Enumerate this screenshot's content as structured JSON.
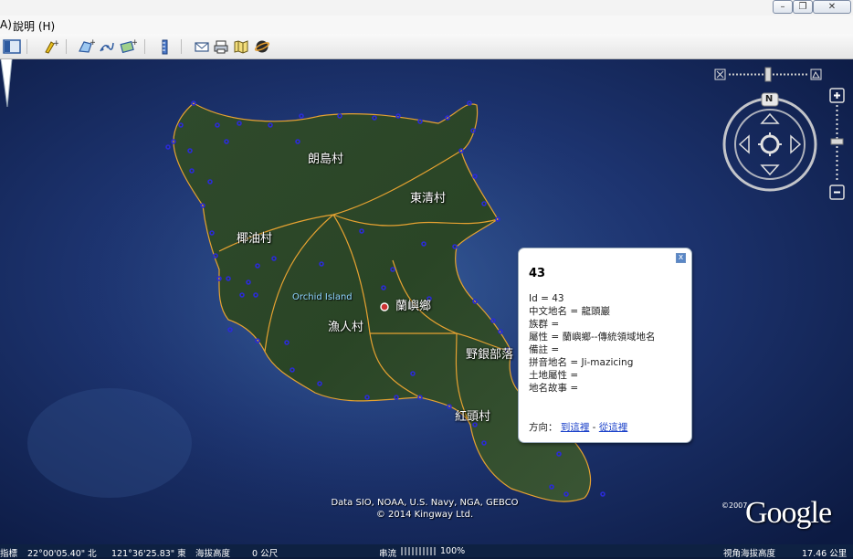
{
  "menu": {
    "items": [
      "A)",
      "說明 (H)"
    ]
  },
  "window": {
    "minimize": "–",
    "restore": "❐",
    "close": "✕"
  },
  "toolbar": {
    "icons": [
      "sidebar-toggle-icon",
      "add-placemark-icon",
      "add-polygon-icon",
      "add-path-icon",
      "add-image-overlay-icon",
      "ruler-icon",
      "email-icon",
      "print-icon",
      "google-maps-icon",
      "sky-planet-icon"
    ]
  },
  "navigation": {
    "compass_north": "N"
  },
  "villages": {
    "langdao": "朗島村",
    "dongqing": "東清村",
    "yeyou": "椰油村",
    "yuren": "漁人村",
    "yeyin": "野銀部落",
    "hongtou": "紅頭村",
    "lanyu_township": "蘭嶼鄉",
    "orchid_island": "Orchid Island"
  },
  "popup": {
    "title": "43",
    "lines": [
      "Id = 43",
      "中文地名 = 龍頭巖",
      "族群 =",
      "屬性 = 蘭嶼鄉--傳統領域地名",
      "備註 =",
      "拼音地名 = Ji-mazicing",
      "土地屬性 =",
      "地名故事 ="
    ],
    "direction_label": "方向：",
    "to_here": "到這裡",
    "separator": " - ",
    "from_here": "從這裡",
    "close": "x"
  },
  "credits": {
    "line1": "Data SIO, NOAA, U.S. Navy, NGA, GEBCO",
    "line2": "© 2014 Kingway Ltd.",
    "year": "©2007",
    "logo": "Google"
  },
  "statusbar": {
    "pointer": "指標",
    "lat": "22°00'05.40\" 北",
    "lon": "121°36'25.83\" 東",
    "elev_label": "海拔高度",
    "elev_value": "0 公尺",
    "stream_label": "串流",
    "stream_percent": "100%",
    "eye_alt_label": "視角海拔高度",
    "eye_alt_value": "17.46 公里"
  },
  "colors": {
    "boundary": "#e6a231",
    "marker": "#2b2bd6",
    "link": "#1a40c9"
  }
}
